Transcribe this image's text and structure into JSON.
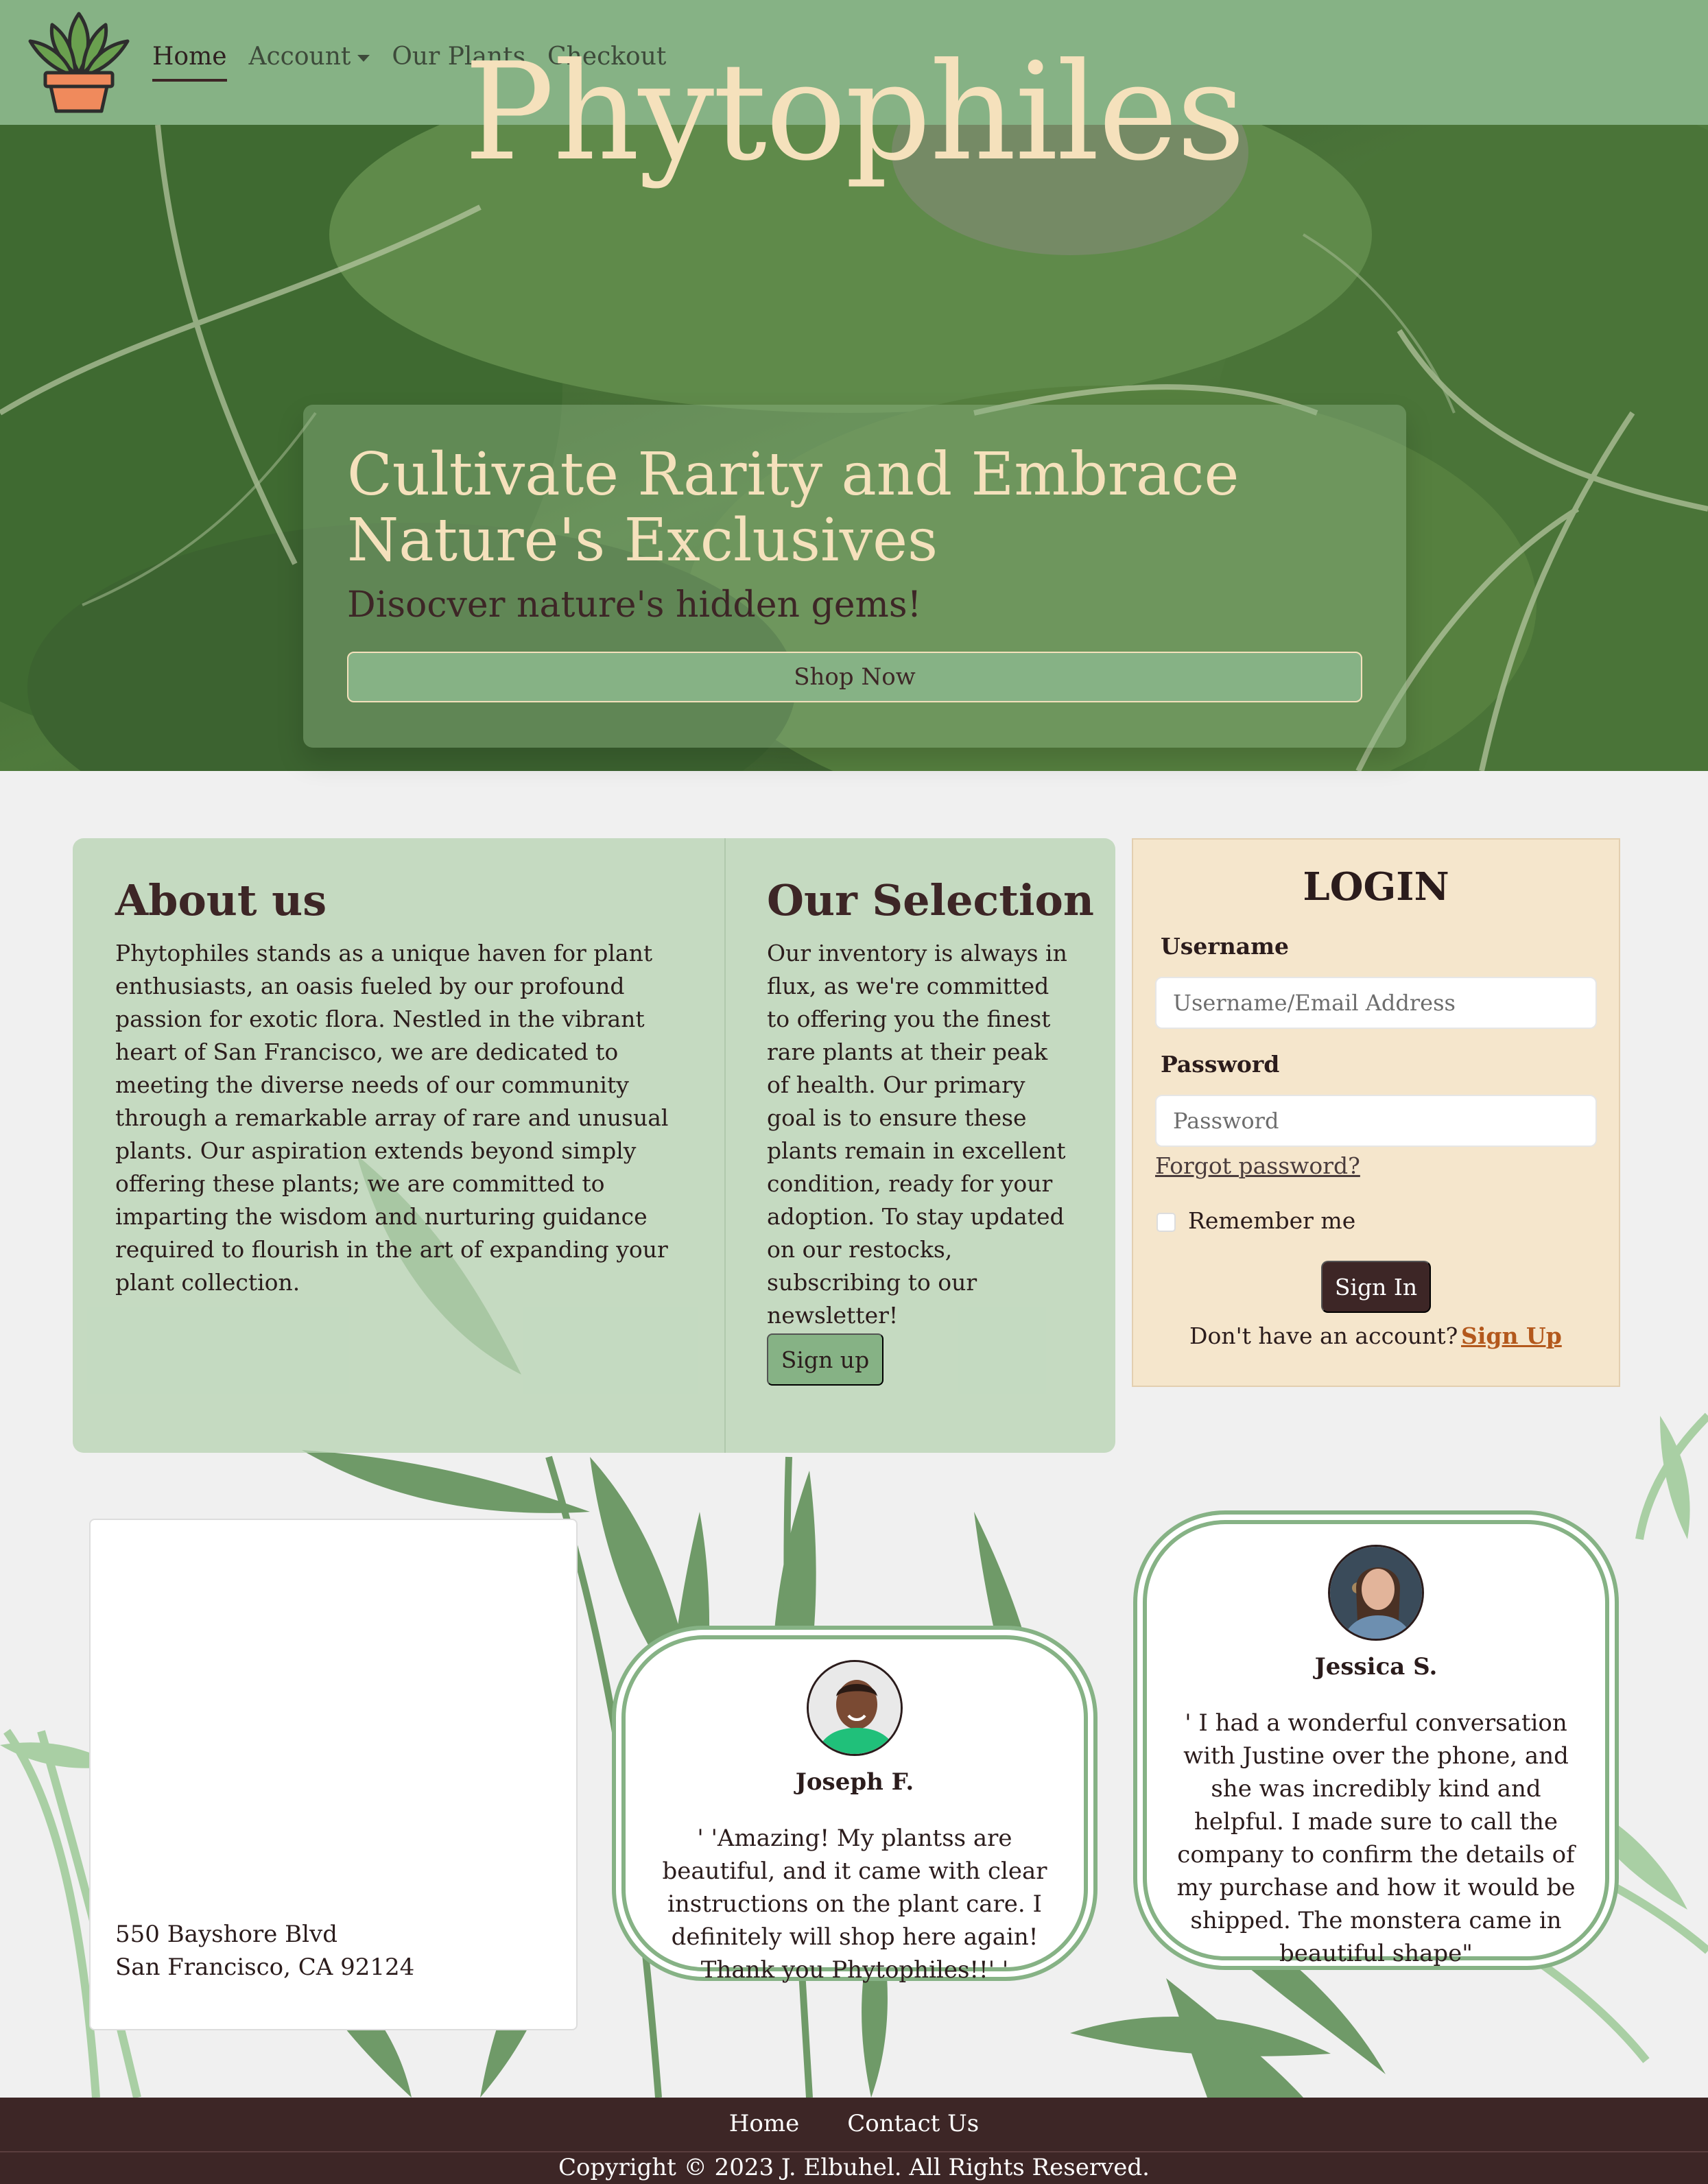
{
  "colors": {
    "nav_bg": "#86b285",
    "cream": "#f5e1bc",
    "dark_brown": "#3d2626",
    "login_bg": "#f5e6cc",
    "link_orange": "#b3581c"
  },
  "nav": {
    "logo_icon": "potted-plant-icon",
    "items": [
      {
        "label": "Home",
        "active": true
      },
      {
        "label": "Account",
        "dropdown": true
      },
      {
        "label": "Our Plants"
      },
      {
        "label": "Checkout"
      }
    ]
  },
  "hero": {
    "title": "Phytophiles",
    "heading": "Cultivate Rarity and Embrace Nature's Exclusives",
    "subheading": "Disocver nature's hidden gems!",
    "button": "Shop Now"
  },
  "about": {
    "title": "About us",
    "text": "Phytophiles stands as a unique haven for plant enthusiasts, an oasis fueled by our profound passion for exotic flora. Nestled in the vibrant heart of San Francisco, we are dedicated to meeting the diverse needs of our community through a remarkable array of rare and unusual plants. Our aspiration extends beyond simply offering these plants; we are committed to imparting the wisdom and nurturing guidance required to flourish in the art of expanding your plant collection."
  },
  "selection": {
    "title": "Our Selection",
    "text": "Our inventory is always in flux, as we're committed to offering you the finest rare plants at their peak of health. Our primary goal is to ensure these plants remain in excellent condition, ready for your adoption. To stay updated on our restocks, subscribing to our newsletter!",
    "button": "Sign up"
  },
  "login": {
    "title": "LOGIN",
    "username_label": "Username",
    "username_placeholder": "Username/Email Address",
    "password_label": "Password",
    "password_placeholder": "Password",
    "forgot": "Forgot password?",
    "remember": "Remember me",
    "submit": "Sign In",
    "no_account": "Don't have an account?",
    "signup": "Sign Up"
  },
  "address": {
    "line1": "550 Bayshore Blvd",
    "line2": "San Francisco, CA 92124"
  },
  "testimonials": [
    {
      "name": "Joseph F.",
      "quote": "' 'Amazing! My plantss are beautiful, and it came with clear instructions on the plant care. I definitely will shop here again! Thank you Phytophiles!!' '"
    },
    {
      "name": "Jessica S.",
      "quote": "' I had a wonderful conversation with Justine over the phone, and she was incredibly kind and helpful. I made sure to call the company to confirm the details of my purchase and how it would be shipped. The monstera came in beautiful shape\""
    }
  ],
  "footer": {
    "links": [
      "Home",
      "Contact Us"
    ],
    "copyright": "Copyright © 2023 J. Elbuhel. All Rights Reserved."
  }
}
